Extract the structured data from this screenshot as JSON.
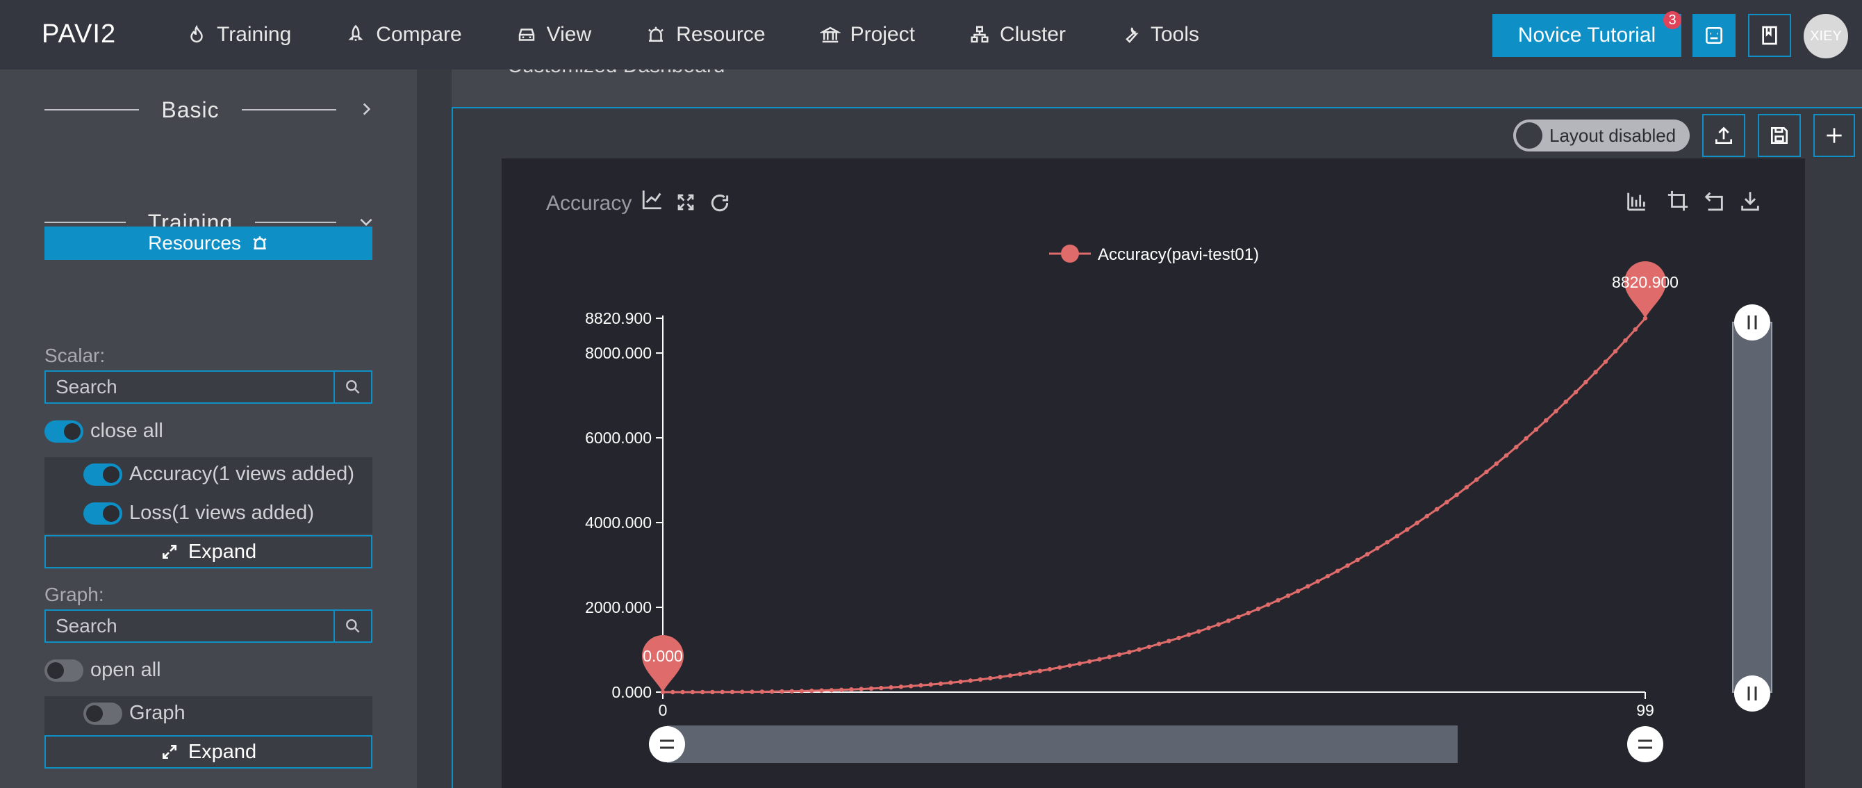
{
  "app": {
    "logo": "PAVI2",
    "nav": [
      {
        "label": "Training",
        "icon": "flame-icon"
      },
      {
        "label": "Compare",
        "icon": "rocket-icon"
      },
      {
        "label": "View",
        "icon": "car-icon"
      },
      {
        "label": "Resource",
        "icon": "alarm-icon"
      },
      {
        "label": "Project",
        "icon": "bank-icon"
      },
      {
        "label": "Cluster",
        "icon": "cluster-icon"
      },
      {
        "label": "Tools",
        "icon": "wrench-icon"
      }
    ],
    "tutorial_label": "Novice Tutorial",
    "tutorial_badge": "3",
    "avatar_text": "XIEY",
    "accent": "#0e8fc6"
  },
  "sidebar": {
    "basic_title": "Basic",
    "training_title": "Training",
    "resources_label": "Resources",
    "scalar_label": "Scalar:",
    "scalar_search_placeholder": "Search",
    "scalar_toggle_label": "close all",
    "scalar_items": [
      "Accuracy(1 views added)",
      "Loss(1 views added)"
    ],
    "expand_label": "Expand",
    "graph_label": "Graph:",
    "graph_search_placeholder": "Search",
    "graph_toggle_label": "open all",
    "graph_items": [
      "Graph"
    ],
    "graph_expand_label": "Expand"
  },
  "main": {
    "dashboard_title": "Customized Dashboard",
    "layout_toggle_label": "Layout disabled",
    "card_title": "Accuracy"
  },
  "chart_data": {
    "type": "line",
    "title": "Accuracy",
    "series": [
      {
        "name": "Accuracy(pavi-test01)",
        "color": "#e06b6b",
        "x_start": 0,
        "x_end": 99,
        "y_start": 0.0,
        "y_end": 8820.9,
        "shape": "cubic growth"
      }
    ],
    "y_ticks": [
      "0.000",
      "2000.000",
      "4000.000",
      "6000.000",
      "8000.000",
      "8820.900"
    ],
    "y_tick_values": [
      0,
      2000,
      4000,
      6000,
      8000,
      8820.9
    ],
    "x_ticks": [
      "0",
      "99"
    ],
    "x_tick_values": [
      0,
      99
    ],
    "ylim": [
      0,
      8820.9
    ],
    "xlim": [
      0,
      99
    ],
    "min_marker": "0.000",
    "max_marker": "8820.900",
    "legend": "top-center",
    "grid": false
  }
}
